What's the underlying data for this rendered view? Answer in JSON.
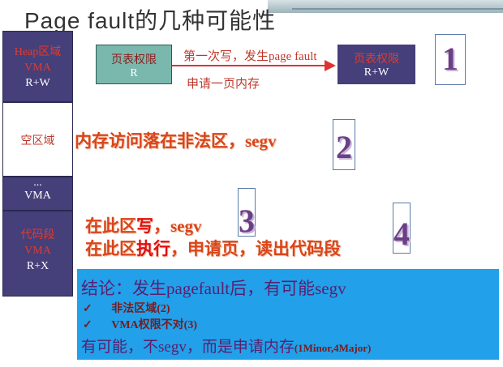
{
  "title": "Page fault的几种可能性",
  "left_column": {
    "heap": {
      "line1": "Heap区域",
      "line2": "VMA",
      "line3": "R+W"
    },
    "empty": {
      "label": "空区域"
    },
    "gap": {
      "dots": "...",
      "label": "VMA"
    },
    "code": {
      "line1": "代码段",
      "line2": "VMA",
      "line3": "R+X"
    }
  },
  "page_table": {
    "box1_line1": "页表权限",
    "box1_line2": "R",
    "box2_line1": "页表权限",
    "box2_line2": "R+W",
    "arrow_top": "第一次写，发生page fault",
    "arrow_bottom": "申请一页内存"
  },
  "cases": {
    "num1": "1",
    "num2": "2",
    "num3": "3",
    "num4": "4",
    "case2": "内存访问落在非法区，segv",
    "case3_prefix": "在此区",
    "case3_highlight": "写",
    "case3_suffix": "，segv",
    "case4_prefix": "在此区",
    "case4_highlight": "执行",
    "case4_suffix": "，申请页，读出代码段"
  },
  "summary": {
    "line1": "结论：发生pagefault后，有可能segv",
    "bullet1": "非法区域(2)",
    "bullet2": "VMA权限不对(3)",
    "bullet_mark": "✓",
    "line4_main": "有可能，不segv，而是申请内存",
    "line4_note": "(1Minor,4Major)"
  },
  "colors": {
    "dark_vma": "#453f7a",
    "summary_bg": "#22a0ea",
    "accent_red": "#d9451a"
  }
}
